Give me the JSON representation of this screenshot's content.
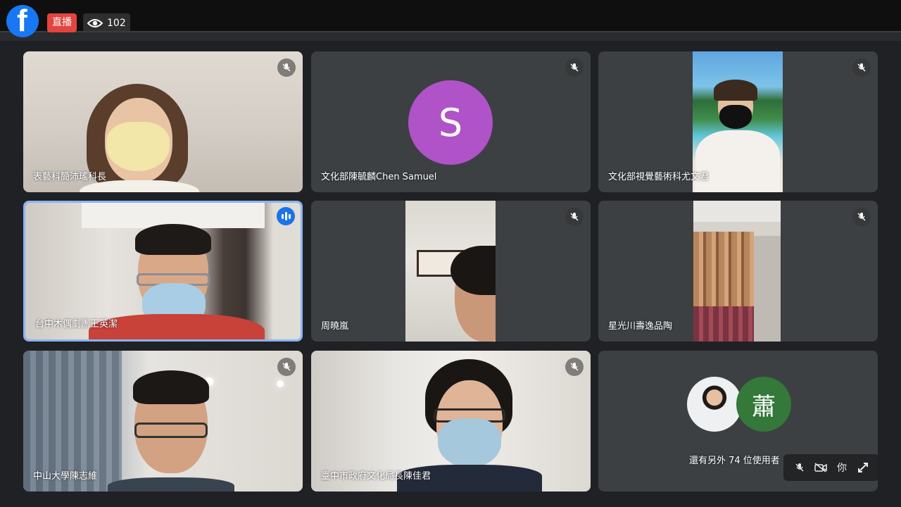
{
  "facebook": {
    "logo_letter": "f",
    "live_label": "直播",
    "viewer_count": "102"
  },
  "tiles": [
    {
      "name": "表藝科簡沛瑤科長",
      "avatar_letter": "",
      "avatar_color": ""
    },
    {
      "name": "文化部陳毓麟Chen Samuel",
      "avatar_letter": "S",
      "avatar_color": "#b052c8"
    },
    {
      "name": "文化部視覺藝術科尤文君",
      "avatar_letter": "",
      "avatar_color": ""
    },
    {
      "name": "台中木偶劇團王英潔",
      "avatar_letter": "",
      "avatar_color": ""
    },
    {
      "name": "周曉嵐",
      "avatar_letter": "",
      "avatar_color": ""
    },
    {
      "name": "星光川壽逸品陶",
      "avatar_letter": "",
      "avatar_color": ""
    },
    {
      "name": "中山大學陳志維",
      "avatar_letter": "",
      "avatar_color": ""
    },
    {
      "name": "臺中市政府文化局長陳佳君",
      "avatar_letter": "",
      "avatar_color": ""
    }
  ],
  "others": {
    "label": "還有另外 74 位使用者",
    "avatar_letter": "蕭",
    "avatar_color": "#34783a"
  },
  "self_controls": {
    "self_label": "你"
  },
  "colors": {
    "tile_bg": "#3c4043",
    "active_border": "#8ab4f8",
    "speaking": "#1a73e8"
  }
}
